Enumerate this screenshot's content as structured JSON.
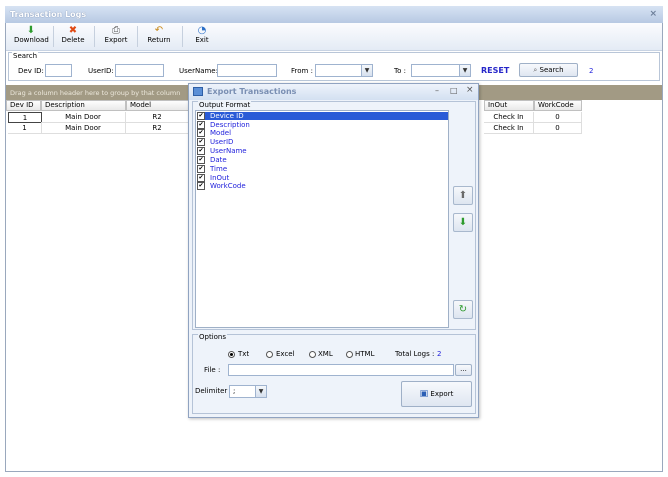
{
  "window": {
    "title": "Transaction Logs",
    "close_glyph": "×"
  },
  "toolbar": {
    "download": "Download",
    "delete": "Delete",
    "export": "Export",
    "return": "Return",
    "exit": "Exit"
  },
  "search": {
    "group_label": "Search",
    "dev_id_label": "Dev ID:",
    "dev_id_value": "",
    "userid_label": "UserID:",
    "userid_value": "",
    "username_label": "UserName:",
    "username_value": "",
    "from_label": "From :",
    "from_value": "",
    "to_label": "To :",
    "to_value": "",
    "reset_label": "RESET",
    "search_label": "Search",
    "count": "2"
  },
  "grid": {
    "group_hint": "Drag a column header here to group by that column",
    "headers": {
      "dev_id": "Dev ID",
      "description": "Description",
      "model": "Model",
      "inout": "InOut",
      "workcode": "WorkCode"
    },
    "rows": [
      {
        "dev_id": "1",
        "description": "Main Door",
        "model": "R2",
        "inout": "Check In",
        "workcode": "0"
      },
      {
        "dev_id": "1",
        "description": "Main Door",
        "model": "R2",
        "inout": "Check In",
        "workcode": "0"
      }
    ]
  },
  "dialog": {
    "title": "Export Transactions",
    "min_glyph": "–",
    "max_glyph": "□",
    "close_glyph": "×",
    "output_format_label": "Output Format",
    "fields": [
      "Device ID",
      "Description",
      "Model",
      "UserID",
      "UserName",
      "Date",
      "Time",
      "InOut",
      "WorkCode"
    ],
    "selected_field": "Device ID",
    "options_label": "Options",
    "formats": [
      "Txt",
      "Excel",
      "XML",
      "HTML"
    ],
    "selected_format": "Txt",
    "total_logs_label": "Total Logs :",
    "total_logs_value": "2",
    "file_label": "File :",
    "file_value": "",
    "browse_label": "...",
    "delimiter_label": "Delimiter :",
    "delimiter_value": ";",
    "export_label": "Export"
  },
  "colors": {
    "accent_blue": "#1d1ddb",
    "group_header": "#a29a84",
    "selection": "#2a5bd7"
  }
}
